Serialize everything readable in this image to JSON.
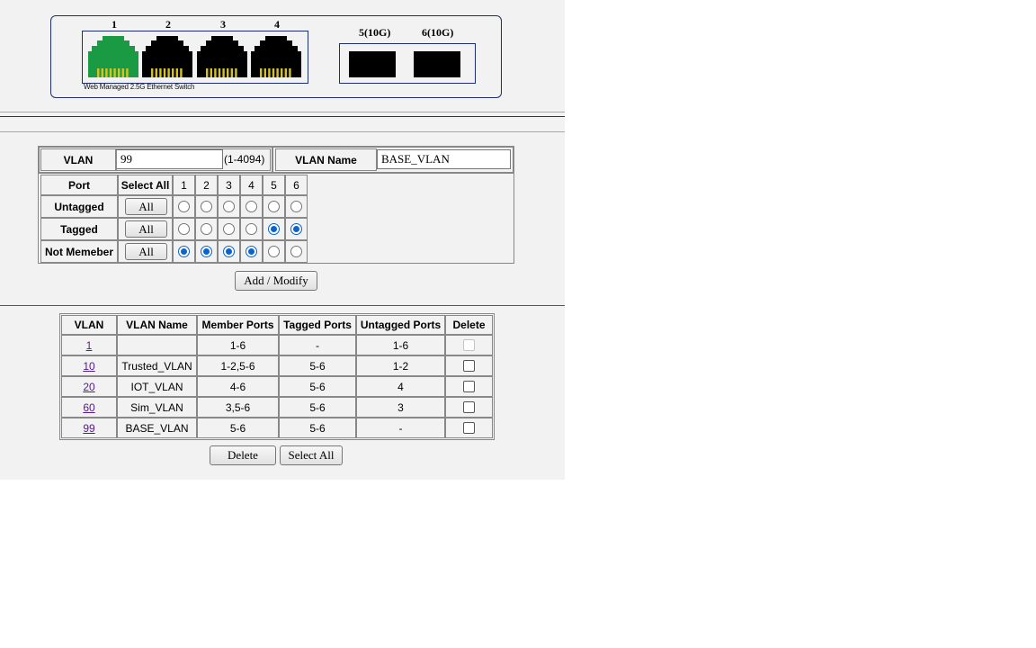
{
  "switch_panel": {
    "rj45_ports": [
      {
        "number": "1",
        "color": "#1a9b43"
      },
      {
        "number": "2",
        "color": "#000000"
      },
      {
        "number": "3",
        "color": "#000000"
      },
      {
        "number": "4",
        "color": "#000000"
      }
    ],
    "model_text": "Web Managed 2.5G Ethernet Switch",
    "sfp_ports": [
      {
        "label": "5(10G)"
      },
      {
        "label": "6(10G)"
      }
    ],
    "pin_color": "#d4c320"
  },
  "vlan_form": {
    "vlan_label": "VLAN",
    "vlan_value": "99",
    "vlan_range": "(1-4094)",
    "name_label": "VLAN Name",
    "name_value": "BASE_VLAN",
    "port_label": "Port",
    "select_all_label": "Select All",
    "ports": [
      "1",
      "2",
      "3",
      "4",
      "5",
      "6"
    ],
    "rows": [
      {
        "label": "Untagged",
        "button": "All",
        "selected": [
          false,
          false,
          false,
          false,
          false,
          false
        ]
      },
      {
        "label": "Tagged",
        "button": "All",
        "selected": [
          false,
          false,
          false,
          false,
          true,
          true
        ]
      },
      {
        "label": "Not Memeber",
        "button": "All",
        "selected": [
          true,
          true,
          true,
          true,
          false,
          false
        ]
      }
    ],
    "submit_label": "Add / Modify",
    "accent": "#0b63ce"
  },
  "vlan_table": {
    "headers": [
      "VLAN",
      "VLAN Name",
      "Member Ports",
      "Tagged Ports",
      "Untagged Ports",
      "Delete"
    ],
    "rows": [
      {
        "vlan": "1",
        "name": "",
        "member": "1-6",
        "tagged": "-",
        "untagged": "1-6",
        "deletable": false
      },
      {
        "vlan": "10",
        "name": "Trusted_VLAN",
        "member": "1-2,5-6",
        "tagged": "5-6",
        "untagged": "1-2",
        "deletable": true
      },
      {
        "vlan": "20",
        "name": "IOT_VLAN",
        "member": "4-6",
        "tagged": "5-6",
        "untagged": "4",
        "deletable": true
      },
      {
        "vlan": "60",
        "name": "Sim_VLAN",
        "member": "3,5-6",
        "tagged": "5-6",
        "untagged": "3",
        "deletable": true
      },
      {
        "vlan": "99",
        "name": "BASE_VLAN",
        "member": "5-6",
        "tagged": "5-6",
        "untagged": "-",
        "deletable": true
      }
    ],
    "delete_label": "Delete",
    "select_all_label": "Select All"
  }
}
